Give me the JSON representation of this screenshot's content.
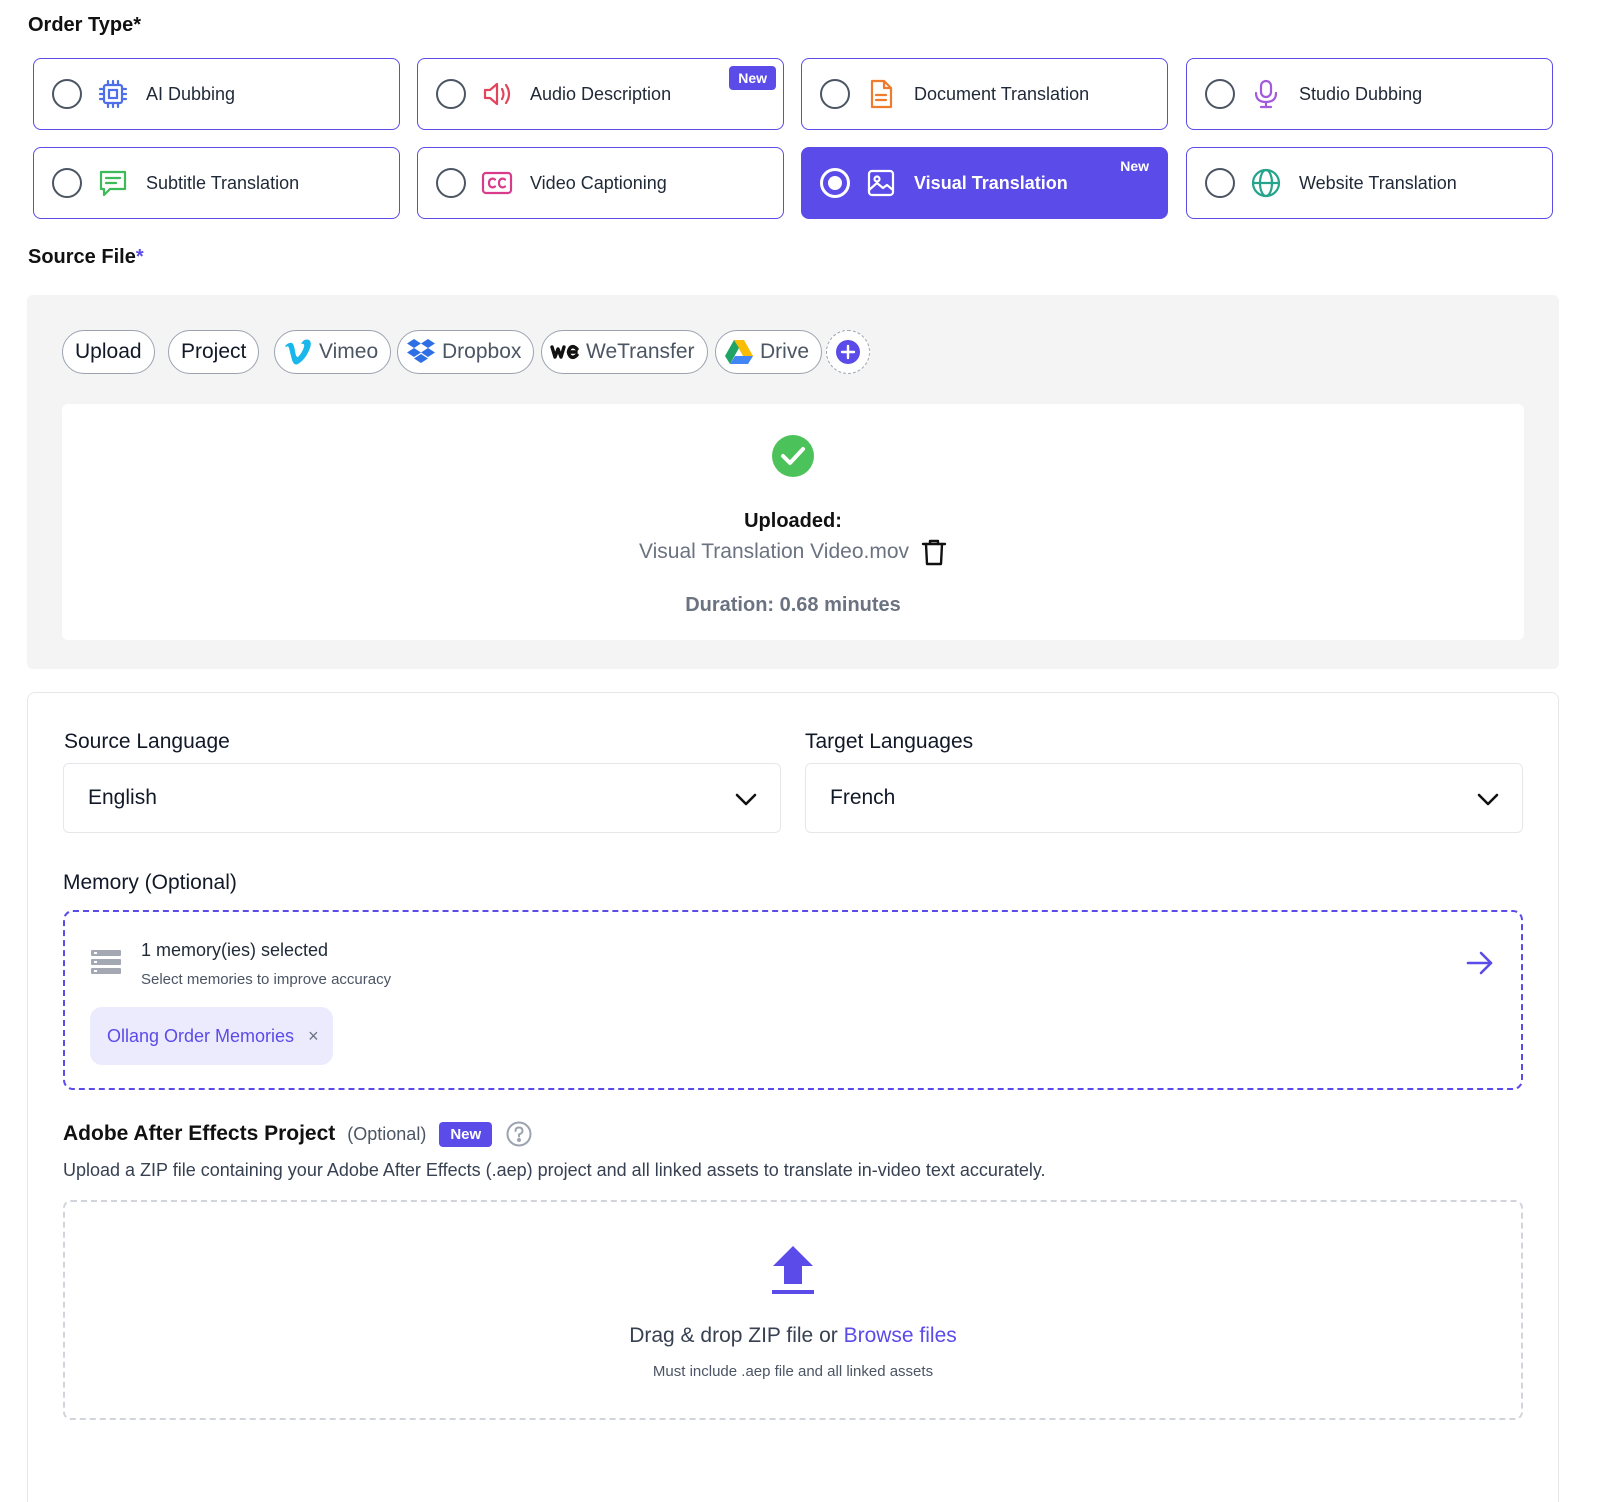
{
  "order_type": {
    "title": "Order Type",
    "required_mark": "*",
    "badge_new": "New",
    "options": [
      {
        "label": "AI Dubbing",
        "icon": "chip-icon",
        "selected": false,
        "is_new": false
      },
      {
        "label": "Audio Description",
        "icon": "speaker-icon",
        "selected": false,
        "is_new": true
      },
      {
        "label": "Document Translation",
        "icon": "document-icon",
        "selected": false,
        "is_new": false
      },
      {
        "label": "Studio Dubbing",
        "icon": "microphone-icon",
        "selected": false,
        "is_new": false
      },
      {
        "label": "Subtitle Translation",
        "icon": "chat-icon",
        "selected": false,
        "is_new": false
      },
      {
        "label": "Video Captioning",
        "icon": "cc-icon",
        "selected": false,
        "is_new": false
      },
      {
        "label": "Visual Translation",
        "icon": "image-icon",
        "selected": true,
        "is_new": true
      },
      {
        "label": "Website Translation",
        "icon": "globe-icon",
        "selected": false,
        "is_new": false
      }
    ]
  },
  "source_file": {
    "title": "Source File",
    "required_mark": "*",
    "sources": [
      {
        "label": "Upload"
      },
      {
        "label": "Project"
      },
      {
        "label": "Vimeo",
        "icon": "vimeo-icon"
      },
      {
        "label": "Dropbox",
        "icon": "dropbox-icon"
      },
      {
        "label": "WeTransfer",
        "icon": "wetransfer-icon"
      },
      {
        "label": "Drive",
        "icon": "google-drive-icon"
      }
    ],
    "uploaded_label": "Uploaded:",
    "file_name": "Visual Translation Video.mov",
    "duration": "Duration: 0.68 minutes"
  },
  "languages": {
    "source_label": "Source Language",
    "source_value": "English",
    "target_label": "Target Languages",
    "target_value": "French"
  },
  "memory": {
    "label": "Memory (Optional)",
    "count_text": "1 memory(ies) selected",
    "hint": "Select memories to improve accuracy",
    "tags": [
      "Ollang Order Memories"
    ],
    "remove_glyph": "×"
  },
  "after_effects": {
    "title": "Adobe After Effects Project",
    "optional": "(Optional)",
    "badge": "New",
    "description": "Upload a ZIP file containing your Adobe After Effects (.aep) project and all linked assets to translate in-video text accurately.",
    "drop_text": "Drag & drop ZIP file or ",
    "browse_link": "Browse files",
    "drop_hint": "Must include .aep file and all linked assets"
  },
  "colors": {
    "accent": "#5B4BE8",
    "success": "#4CC35A",
    "panel_bg": "#F4F4F5"
  }
}
